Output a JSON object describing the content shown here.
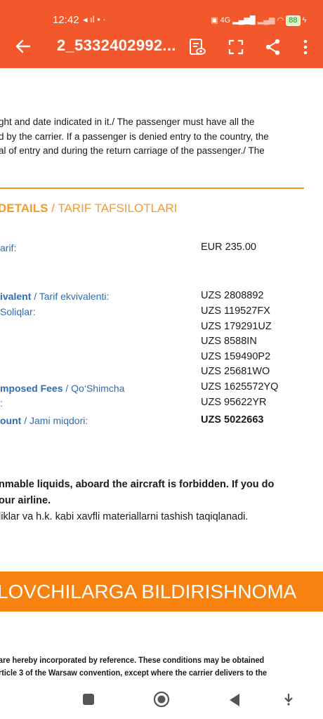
{
  "status": {
    "time": "12:42",
    "left_icons": "◂  ıl  •  ·",
    "network": "4G",
    "battery": "88",
    "charging": "ϟ"
  },
  "appbar": {
    "title": "2_5332402992..."
  },
  "document": {
    "intro_lines": [
      "ght and date indicated in it./ The passenger must have all the",
      "d by the carrier. If a passenger is denied entry to the country, the",
      "al of entry and during the return carriage of the passenger./ The"
    ],
    "section_title_en": "DETAILS",
    "section_title_sep": " / ",
    "section_title_uz": "TARIF TAFSILOTLARI",
    "fare": {
      "label": "arif:",
      "value": "EUR 235.00"
    },
    "equivalent": {
      "label_en": "ivalent",
      "label_uz": " / Tarif ekvivalenti:",
      "value": "UZS 2808892"
    },
    "taxes": {
      "label": "Soliqlar:",
      "values": [
        "UZS 119527FX",
        "UZS 179291UZ",
        "UZS 8588IN",
        "UZS 159490P2",
        "UZS 25681WO"
      ]
    },
    "fees": {
      "label_en": "mposed Fees",
      "label_uz": " / Qo‘Shimcha",
      "label_line2": ":",
      "values": [
        "UZS 1625572YQ",
        "UZS 95622YR"
      ]
    },
    "total": {
      "label_en": "ount",
      "label_uz": " / Jami miqdori:",
      "value": "UZS 5022663"
    },
    "notice": {
      "line1": "nmable liquids, aboard the aircraft is forbidden. If you do",
      "line2": "our airline.",
      "line3": "liklar va h.k. kabi xavfli materiallarni tashish taqiqlanadi."
    },
    "banner": "LOVCHILARGA BILDIRISHNOMA",
    "footer": {
      "line1": "are hereby incorporated by reference. These conditions may be obtained",
      "line2": "rticle 3 of the Warsaw convention, except where the carrier delivers to the"
    }
  },
  "colors": {
    "appbar": "#f2582c",
    "accent": "#f29a2e",
    "label_blue": "#2e6db5",
    "banner": "#f7820f"
  }
}
